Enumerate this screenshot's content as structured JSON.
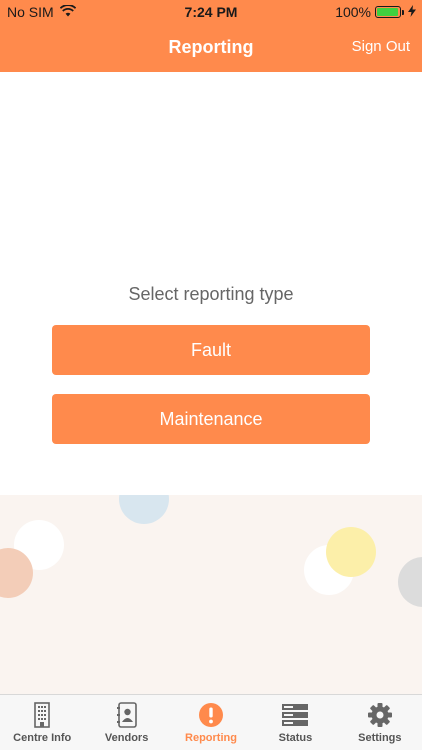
{
  "status_bar": {
    "carrier": "No SIM",
    "time": "7:24 PM",
    "battery": "100%",
    "battery_level": 1.0
  },
  "nav": {
    "title": "Reporting",
    "sign_out": "Sign Out"
  },
  "content": {
    "prompt": "Select reporting type",
    "fault_label": "Fault",
    "maintenance_label": "Maintenance"
  },
  "tabs": [
    {
      "label": "Centre Info",
      "icon": "building-icon",
      "active": false
    },
    {
      "label": "Vendors",
      "icon": "contacts-icon",
      "active": false
    },
    {
      "label": "Reporting",
      "icon": "exclamation-icon",
      "active": true
    },
    {
      "label": "Status",
      "icon": "server-icon",
      "active": false
    },
    {
      "label": "Settings",
      "icon": "gear-icon",
      "active": false
    }
  ],
  "colors": {
    "accent": "#ff8a4c",
    "battery": "#3fd03f",
    "text_gray": "#666666"
  }
}
